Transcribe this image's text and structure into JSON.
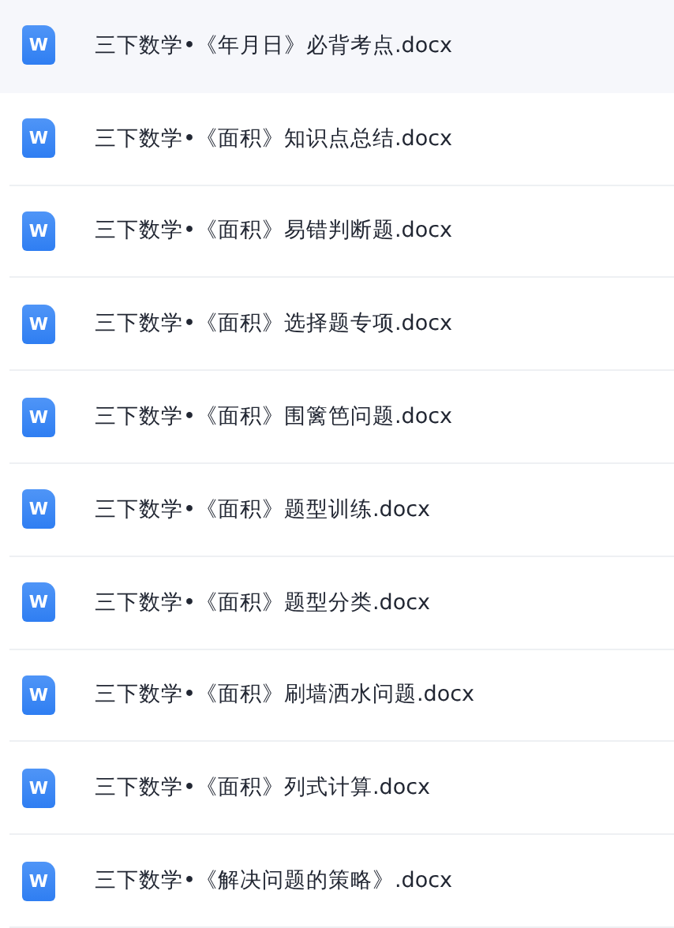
{
  "files": [
    {
      "name": "三下数学•《年月日》必背考点.docx",
      "icon_letter": "W",
      "selected": true
    },
    {
      "name": "三下数学•《面积》知识点总结.docx",
      "icon_letter": "W",
      "selected": false
    },
    {
      "name": "三下数学•《面积》易错判断题.docx",
      "icon_letter": "W",
      "selected": false
    },
    {
      "name": "三下数学•《面积》选择题专项.docx",
      "icon_letter": "W",
      "selected": false
    },
    {
      "name": "三下数学•《面积》围篱笆问题.docx",
      "icon_letter": "W",
      "selected": false
    },
    {
      "name": "三下数学•《面积》题型训练.docx",
      "icon_letter": "W",
      "selected": false
    },
    {
      "name": "三下数学•《面积》题型分类.docx",
      "icon_letter": "W",
      "selected": false
    },
    {
      "name": "三下数学•《面积》刷墙洒水问题.docx",
      "icon_letter": "W",
      "selected": false
    },
    {
      "name": "三下数学•《面积》列式计算.docx",
      "icon_letter": "W",
      "selected": false
    },
    {
      "name": "三下数学•《解决问题的策略》.docx",
      "icon_letter": "W",
      "selected": false
    }
  ]
}
